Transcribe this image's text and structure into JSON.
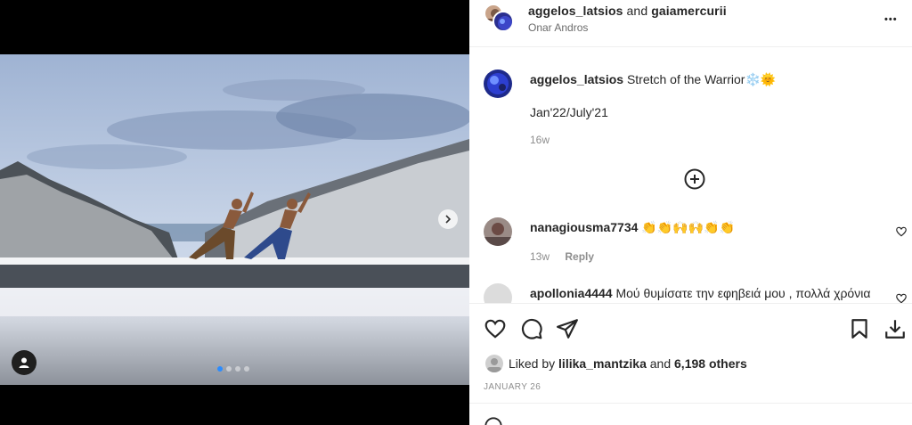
{
  "post": {
    "authors_primary": "aggelos_latsios",
    "authors_joiner": "and",
    "authors_secondary": "gaiamercurii",
    "location": "Onar Andros",
    "more_label": "•••"
  },
  "caption": {
    "username": "aggelos_latsios",
    "text": "Stretch of the Warrior❄️🌞",
    "line2": "Jan'22/July'21",
    "age": "16w"
  },
  "comments": [
    {
      "username": "nanagiousma7734",
      "text": "👏👏🙌🙌👏👏",
      "age": "13w",
      "reply_label": "Reply"
    },
    {
      "username": "apollonia4444",
      "text": "Μού θυμίσατε την εφηβειά μου , πολλά χρόνια"
    }
  ],
  "engagement": {
    "liked_by_prefix": "Liked by",
    "liked_by_user": "lilika_mantzika",
    "liked_by_joiner": "and",
    "others_count": "6,198 others",
    "date": "JANUARY 26"
  },
  "carousel": {
    "count": 4,
    "active_index": 0
  },
  "colors": {
    "accent": "#0095f6",
    "secondary_text": "#8e8e8e",
    "divider": "#efefef"
  },
  "icons": [
    "user-tag-icon",
    "chevron-right-icon",
    "plus-circle-icon",
    "heart-icon",
    "comment-icon",
    "share-icon",
    "bookmark-icon",
    "download-icon",
    "more-icon"
  ]
}
